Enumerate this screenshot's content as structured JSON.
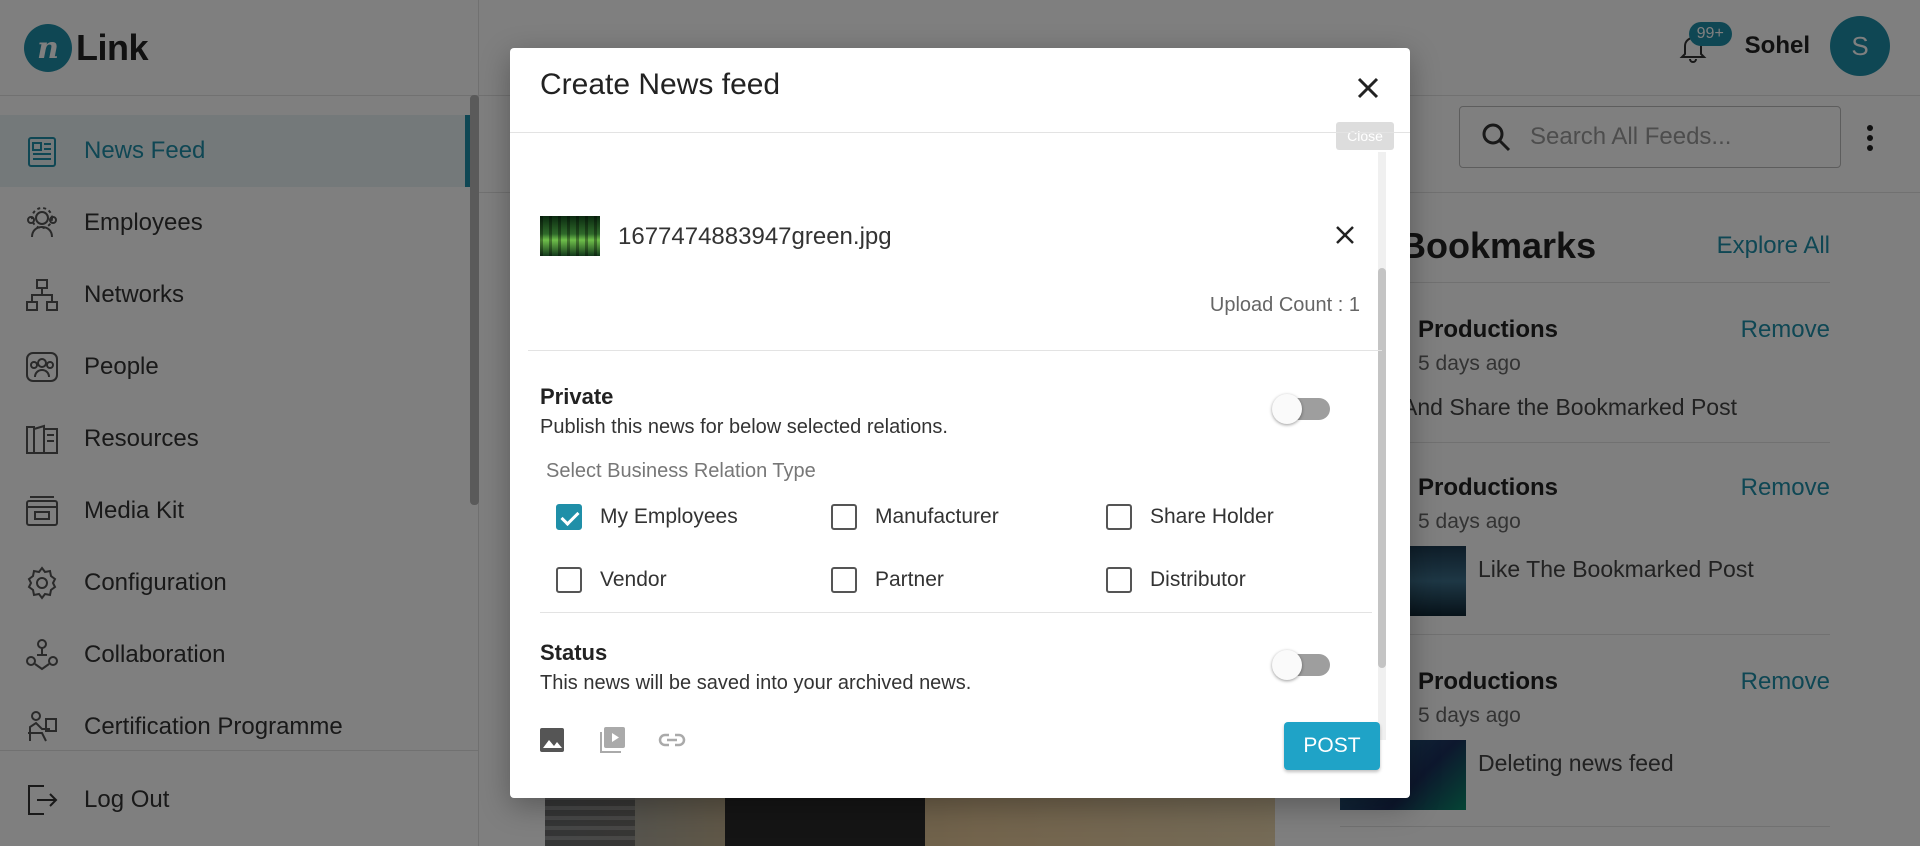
{
  "app": {
    "logo_text": "Link",
    "logo_mark": "n"
  },
  "sidebar": {
    "items": [
      {
        "label": "News Feed",
        "icon": "newspaper-icon",
        "active": true
      },
      {
        "label": "Employees",
        "icon": "employees-icon"
      },
      {
        "label": "Networks",
        "icon": "network-icon"
      },
      {
        "label": "People",
        "icon": "people-icon"
      },
      {
        "label": "Resources",
        "icon": "book-icon"
      },
      {
        "label": "Media Kit",
        "icon": "media-kit-icon"
      },
      {
        "label": "Configuration",
        "icon": "gear-icon"
      },
      {
        "label": "Collaboration",
        "icon": "collaboration-icon"
      },
      {
        "label": "Certification Programme",
        "icon": "certificate-icon"
      }
    ],
    "logout_label": "Log Out"
  },
  "header": {
    "notification_badge": "99+",
    "user_name": "Sohel",
    "avatar_initial": "S",
    "search_placeholder": "Search All Feeds..."
  },
  "bookmarks": {
    "title": "Bookmarks",
    "explore_label": "Explore All",
    "items": [
      {
        "name": "Productions",
        "remove_label": "Remove",
        "time": "5 days ago",
        "text": "And Share the Bookmarked Post"
      },
      {
        "name": "Productions",
        "remove_label": "Remove",
        "time": "5 days ago",
        "text": "Like The Bookmarked Post"
      },
      {
        "name": "Productions",
        "remove_label": "Remove",
        "time": "5 days ago",
        "text": "Deleting news feed"
      }
    ]
  },
  "modal": {
    "title": "Create News feed",
    "close_tooltip": "Close",
    "file": {
      "name": "1677474883947green.jpg"
    },
    "upload_count": "Upload Count : 1",
    "private": {
      "title": "Private",
      "description": "Publish this news for below selected relations.",
      "enabled": false
    },
    "relation_label": "Select Business Relation Type",
    "relations": [
      {
        "label": "My Employees",
        "checked": true
      },
      {
        "label": "Manufacturer",
        "checked": false
      },
      {
        "label": "Share Holder",
        "checked": false
      },
      {
        "label": "Vendor",
        "checked": false
      },
      {
        "label": "Partner",
        "checked": false
      },
      {
        "label": "Distributor",
        "checked": false
      }
    ],
    "status": {
      "title": "Status",
      "description": "This news will be saved into your archived news.",
      "enabled": false
    },
    "footer_icons": [
      "image-icon",
      "video-icon",
      "link-icon"
    ],
    "post_label": "POST"
  },
  "colors": {
    "accent": "#1f8fa8",
    "post_button": "#1fa3c7"
  }
}
